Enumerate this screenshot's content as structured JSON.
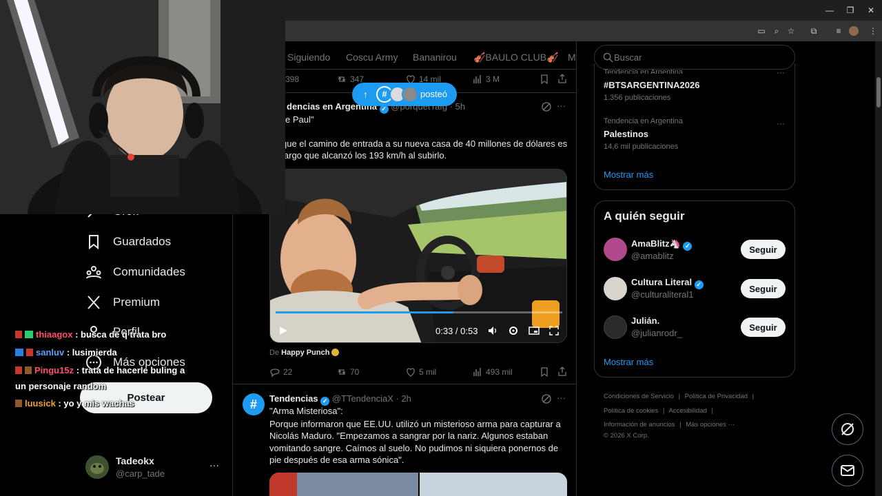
{
  "colors": {
    "accent": "#1d9bf0",
    "verified": "#1d9bf0",
    "text": "#e7e9ea",
    "muted": "#71767b",
    "border": "#2f3336"
  },
  "tabs": [
    "Siguiendo",
    "Coscu Army",
    "Bananirou",
    "🎻BAULO CLUB🎻",
    "M"
  ],
  "nav": {
    "grok": "Grok",
    "bookmarks": "Guardados",
    "communities": "Comunidades",
    "premium": "Premium",
    "profile": "Perfil",
    "more": "Más opciones",
    "post": "Postear"
  },
  "account": {
    "name": "Tadeokx",
    "handle": "@carp_tade"
  },
  "top_stats": {
    "views_partial": "398",
    "retweets": "347",
    "likes": "14 mil",
    "views": "3 M"
  },
  "new_posts_pill": {
    "label": "posteó"
  },
  "tweet1": {
    "author_partial": "dencias en Argentina",
    "handle_partial": "@porquetTafg",
    "time": "· 5h",
    "line1": "e Paul\"",
    "body": "que el camino de entrada a su nueva casa de 40 millones de dólares es\nlargo que alcanzó los 193 km/h al subirlo.",
    "video_time": "0:33 / 0:53",
    "video_progress": 0.62,
    "from_label": "De",
    "from_name": "Happy Punch",
    "replies": "22",
    "retweets": "70",
    "likes": "5 mil",
    "views": "493 mil"
  },
  "tweet2": {
    "author": "Tendencias",
    "handle": "@TTendenciaX",
    "time": "· 2h",
    "title": "\"Arma Misteriosa\":",
    "body": "Porque informaron que EE.UU. utilizó un misterioso arma para capturar a Nicolás Maduro. \"Empezamos a sangrar por la nariz. Algunos estaban vomitando sangre. Caímos al suelo. No pudimos ni siquiera ponernos de pie después de esa arma sónica\"."
  },
  "search": {
    "placeholder": "Buscar"
  },
  "trends": [
    {
      "context": "Tendencia en Argentina",
      "name": "#BTSARGENTINA2026",
      "count": "1.356 publicaciones"
    },
    {
      "context": "Tendencia en Argentina",
      "name": "Palestinos",
      "count": "14,6 mil publicaciones"
    }
  ],
  "show_more": "Mostrar más",
  "who_to_follow": {
    "title": "A quién seguir",
    "follow_label": "Seguir",
    "show_more": "Mostrar más",
    "users": [
      {
        "name": "AmaBlitz🦄",
        "handle": "@amablitz",
        "verified": true,
        "color": "#b04a8c"
      },
      {
        "name": "Cultura Literal",
        "handle": "@culturaliteral1",
        "verified": true,
        "color": "#d9d4cc"
      },
      {
        "name": "Julián.",
        "handle": "@julianrodr_",
        "verified": false,
        "color": "#2a2a2a"
      }
    ]
  },
  "footer": {
    "links": [
      "Condiciones de Servicio",
      "Política de Privacidad",
      "Política de cookies",
      "Accesibilidad",
      "Información de anuncios",
      "Más opciones ···"
    ],
    "copyright": "© 2026 X Corp."
  },
  "chat": [
    {
      "user": "thiaagox",
      "color": "#ff4f6d",
      "message": ": busca de q trata bro"
    },
    {
      "user": "sanluv",
      "color": "#5aa0ff",
      "message": ": lusimierda"
    },
    {
      "user": "Pingu15z",
      "color": "#ff4f6d",
      "message": ": trata de hacerle buling a",
      "message2": "un personaje random"
    },
    {
      "user": "luusick",
      "color": "#f0a030",
      "message": ": yo y mis wachas"
    }
  ]
}
